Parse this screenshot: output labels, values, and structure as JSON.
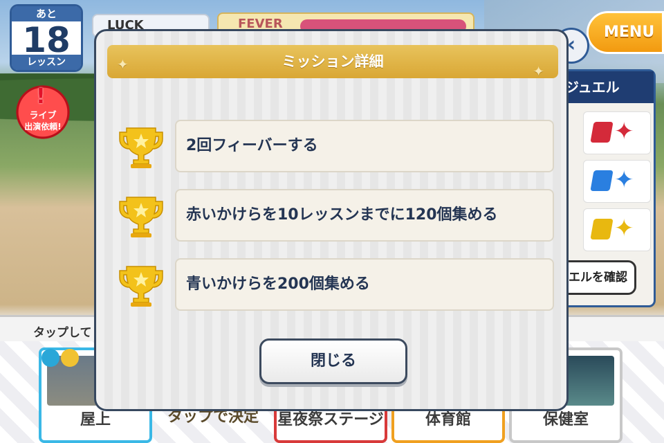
{
  "hud": {
    "days_prefix": "あと",
    "days_left": "18",
    "days_unit": "レッスン",
    "live_line1": "ライブ",
    "live_line2": "出演依頼!",
    "luck_label": "LUCK",
    "fever_label": "FEVER",
    "menu_label": "MENU"
  },
  "jewel_panel": {
    "title": "ジュエル",
    "check_button": "エルを確認",
    "jewels": [
      {
        "color": "#d42a3a"
      },
      {
        "color": "#2a7fe0"
      },
      {
        "color": "#e8b810"
      }
    ]
  },
  "footer": {
    "tap_hint": "タップして",
    "locations": [
      "屋上",
      "タップで決定",
      "星夜祭ステージ",
      "体育館",
      "保健室"
    ]
  },
  "modal": {
    "title": "ミッション詳細",
    "missions": [
      {
        "text": "2回フィーバーする"
      },
      {
        "text": "赤いかけらを10レッスンまでに120個集める"
      },
      {
        "text": "青いかけらを200個集める"
      }
    ],
    "close_label": "閉じる"
  }
}
